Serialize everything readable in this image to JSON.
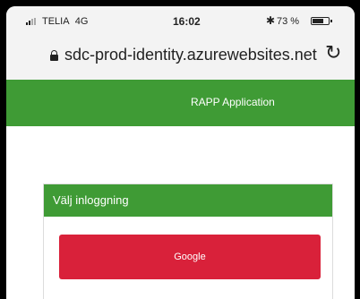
{
  "status_bar": {
    "carrier": "TELIA",
    "network": "4G",
    "time": "16:02",
    "bluetooth_icon": "✱",
    "battery_text": "73 %",
    "battery_level": 0.73
  },
  "browser": {
    "url": "sdc-prod-identity.azurewebsites.net",
    "reload_glyph": "↻"
  },
  "app": {
    "title": "RAPP Application",
    "accent_color": "#3f9b35"
  },
  "login": {
    "heading": "Välj inloggning",
    "providers": [
      {
        "label": "Google",
        "color": "#d9213a"
      }
    ]
  }
}
